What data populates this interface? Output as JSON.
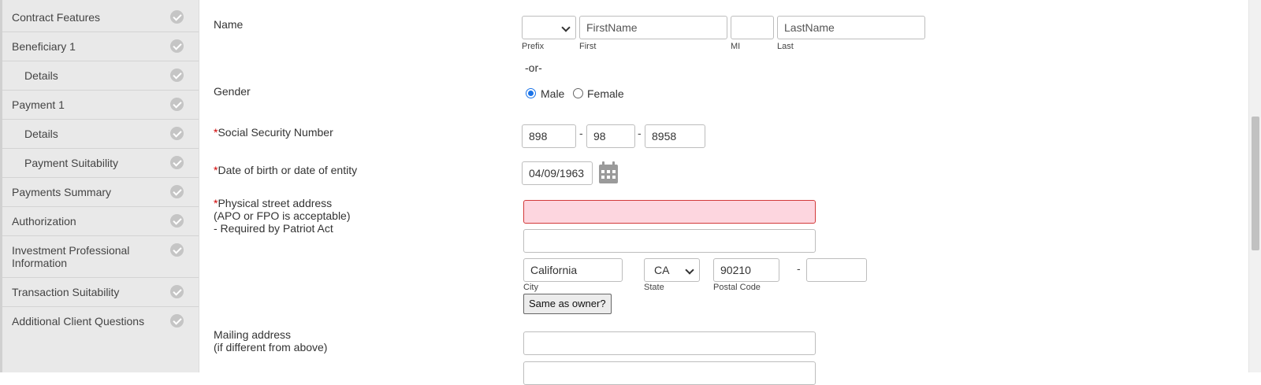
{
  "sidebar": {
    "items": [
      {
        "label": "Contract Features"
      },
      {
        "label": "Beneficiary 1"
      },
      {
        "label": "Details"
      },
      {
        "label": "Payment 1"
      },
      {
        "label": "Details"
      },
      {
        "label": "Payment Suitability"
      },
      {
        "label": "Payments Summary"
      },
      {
        "label": "Authorization"
      },
      {
        "label": "Investment Professional Information"
      },
      {
        "label": "Transaction Suitability"
      },
      {
        "label": "Additional Client Questions"
      }
    ]
  },
  "form": {
    "name": {
      "label": "Name",
      "prefix_value": "",
      "first_placeholder": "FirstName",
      "mi_value": "",
      "last_placeholder": "LastName",
      "prefix_label": "Prefix",
      "first_label": "First",
      "mi_label": "MI",
      "last_label": "Last",
      "or_text": "-or-"
    },
    "gender": {
      "label": "Gender",
      "male_label": "Male",
      "female_label": "Female",
      "selected": "Male"
    },
    "ssn": {
      "required_mark": "*",
      "label": "Social Security Number",
      "part1": "898",
      "part2": "98",
      "part3": "8958",
      "separator": "-"
    },
    "dob": {
      "required_mark": "*",
      "label": "Date of birth or date of entity",
      "value": "04/09/1963"
    },
    "address": {
      "required_mark": "*",
      "label_line1": "Physical street address",
      "label_line2": "(APO or FPO is acceptable)",
      "label_line3": "- Required by Patriot Act",
      "street1": "",
      "street2": "",
      "city": "California",
      "city_label": "City",
      "state": "CA",
      "state_label": "State",
      "postal": "90210",
      "postal_label": "Postal Code",
      "postal_ext": "",
      "separator": "-",
      "same_as_owner_button": "Same as owner?"
    },
    "mailing": {
      "label_line1": "Mailing address",
      "label_line2": "(if different from above)",
      "street1": "",
      "street2": ""
    }
  },
  "colors": {
    "sidebar_bg": "#e9e9e9",
    "error_bg": "#fdd6df",
    "error_border": "#d23a3a",
    "required": "#d00000",
    "radio_selected": "#1a73e8"
  }
}
